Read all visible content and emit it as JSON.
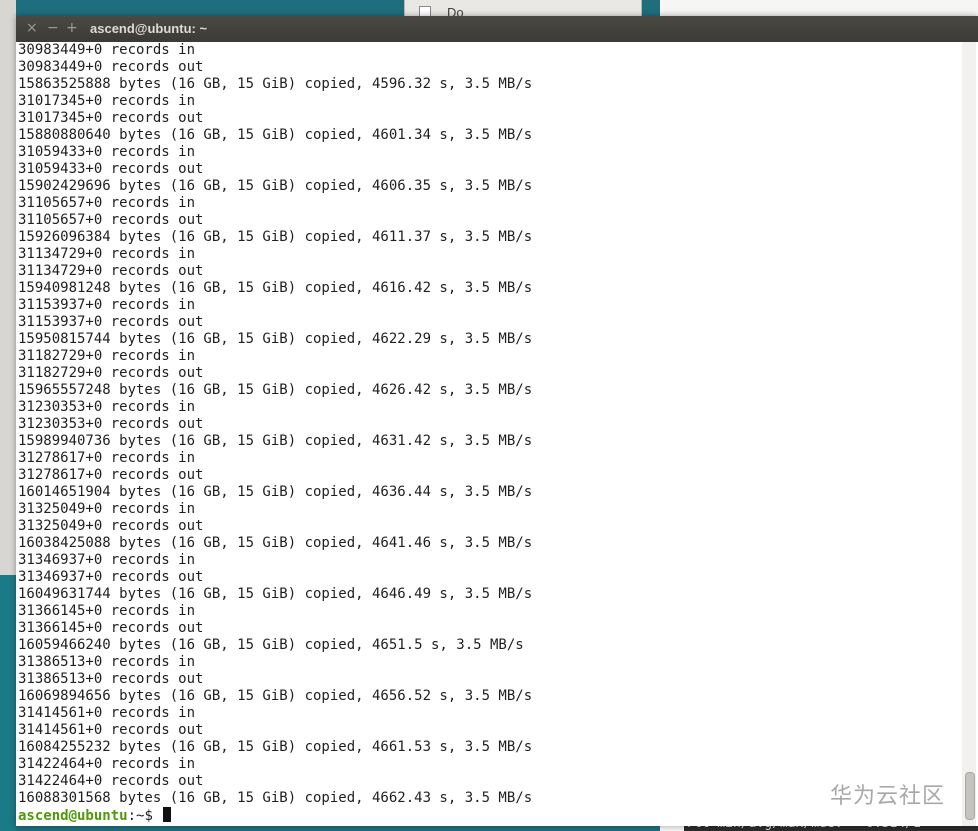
{
  "window": {
    "title": "ascend@ubuntu: ~",
    "close_glyph": "×",
    "min_glyph": "−",
    "max_glyph": "+"
  },
  "background": {
    "doc_label": "Do",
    "peek_text": "rtt min/avg/max/mdev = 0.314/1"
  },
  "terminal": {
    "lines": [
      "30983449+0 records in",
      "30983449+0 records out",
      "15863525888 bytes (16 GB, 15 GiB) copied, 4596.32 s, 3.5 MB/s",
      "31017345+0 records in",
      "31017345+0 records out",
      "15880880640 bytes (16 GB, 15 GiB) copied, 4601.34 s, 3.5 MB/s",
      "31059433+0 records in",
      "31059433+0 records out",
      "15902429696 bytes (16 GB, 15 GiB) copied, 4606.35 s, 3.5 MB/s",
      "31105657+0 records in",
      "31105657+0 records out",
      "15926096384 bytes (16 GB, 15 GiB) copied, 4611.37 s, 3.5 MB/s",
      "31134729+0 records in",
      "31134729+0 records out",
      "15940981248 bytes (16 GB, 15 GiB) copied, 4616.42 s, 3.5 MB/s",
      "31153937+0 records in",
      "31153937+0 records out",
      "15950815744 bytes (16 GB, 15 GiB) copied, 4622.29 s, 3.5 MB/s",
      "31182729+0 records in",
      "31182729+0 records out",
      "15965557248 bytes (16 GB, 15 GiB) copied, 4626.42 s, 3.5 MB/s",
      "31230353+0 records in",
      "31230353+0 records out",
      "15989940736 bytes (16 GB, 15 GiB) copied, 4631.42 s, 3.5 MB/s",
      "31278617+0 records in",
      "31278617+0 records out",
      "16014651904 bytes (16 GB, 15 GiB) copied, 4636.44 s, 3.5 MB/s",
      "31325049+0 records in",
      "31325049+0 records out",
      "16038425088 bytes (16 GB, 15 GiB) copied, 4641.46 s, 3.5 MB/s",
      "31346937+0 records in",
      "31346937+0 records out",
      "16049631744 bytes (16 GB, 15 GiB) copied, 4646.49 s, 3.5 MB/s",
      "31366145+0 records in",
      "31366145+0 records out",
      "16059466240 bytes (16 GB, 15 GiB) copied, 4651.5 s, 3.5 MB/s",
      "31386513+0 records in",
      "31386513+0 records out",
      "16069894656 bytes (16 GB, 15 GiB) copied, 4656.52 s, 3.5 MB/s",
      "31414561+0 records in",
      "31414561+0 records out",
      "16084255232 bytes (16 GB, 15 GiB) copied, 4661.53 s, 3.5 MB/s",
      "31422464+0 records in",
      "31422464+0 records out",
      "16088301568 bytes (16 GB, 15 GiB) copied, 4662.43 s, 3.5 MB/s"
    ],
    "prompt": {
      "user_host": "ascend@ubuntu",
      "colon": ":",
      "path": "~",
      "symbol": "$ "
    }
  },
  "watermark": "华为云社区",
  "colors": {
    "prompt_user": "#4e9a06",
    "titlebar": "#3b3a36",
    "desktop": "#1e6e7e"
  }
}
